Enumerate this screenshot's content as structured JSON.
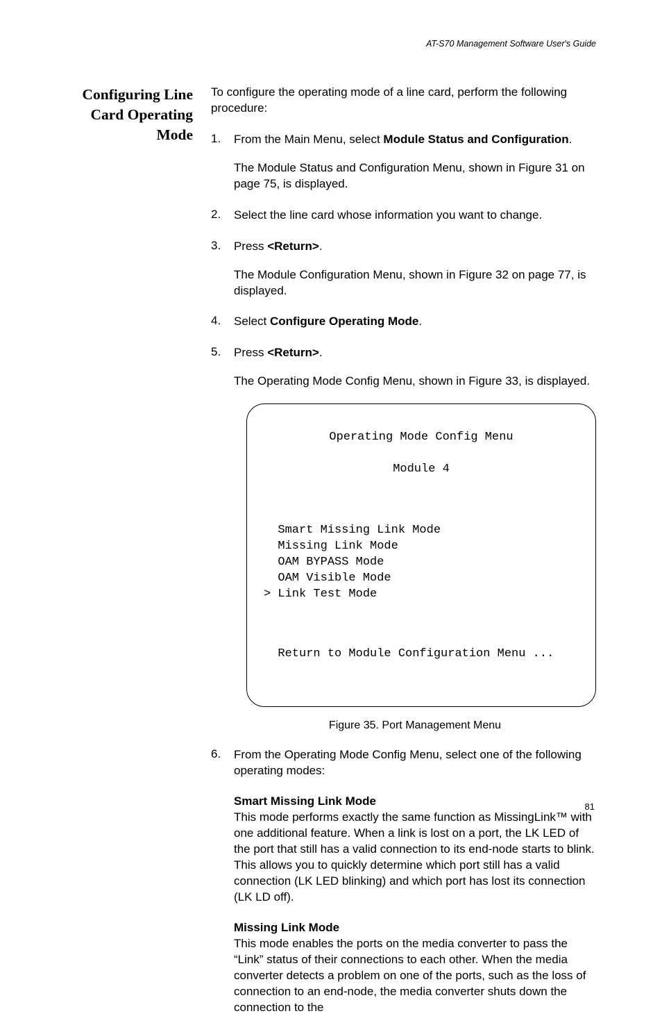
{
  "header": "AT-S70 Management Software User's Guide",
  "sidebarHeading": "Configuring Line Card Operating\nMode",
  "intro": "To configure the operating mode of a line card, perform the following procedure:",
  "steps": {
    "s1": {
      "pre": "From the Main Menu, select ",
      "bold": "Module Status and Configuration",
      "post": ".",
      "after": "The Module Status and Configuration Menu, shown in Figure 31 on page 75, is displayed."
    },
    "s2": {
      "text": "Select the line card whose information you want to change."
    },
    "s3": {
      "pre": "Press ",
      "bold": "<Return>",
      "post": ".",
      "after": "The Module Configuration Menu, shown in Figure 32 on page 77, is displayed."
    },
    "s4": {
      "pre": "Select ",
      "bold": "Configure Operating Mode",
      "post": "."
    },
    "s5": {
      "pre": "Press ",
      "bold": "<Return>",
      "post": ".",
      "after": "The Operating Mode Config Menu, shown in Figure 33, is displayed."
    },
    "s6": {
      "text": "From the Operating Mode Config Menu, select one of the following operating modes:"
    }
  },
  "menu": {
    "title1": "Operating Mode Config Menu",
    "title2": "Module 4",
    "item1": "  Smart Missing Link Mode",
    "item2": "  Missing Link Mode",
    "item3": "  OAM BYPASS Mode",
    "item4": "  OAM Visible Mode",
    "item5": "> Link Test Mode",
    "ret": "  Return to Module Configuration Menu ..."
  },
  "figureCaption": "Figure 35. Port Management Menu",
  "modes": {
    "smart": {
      "title": "Smart Missing Link Mode",
      "body": "This mode performs exactly the same function as MissingLink™ with one additional feature. When a link is lost on a port, the LK LED of the port that still has a valid connection to its end-node starts to blink. This allows you to quickly determine which port still has a valid connection (LK LED blinking) and which port has lost its connection (LK LD off)."
    },
    "missing": {
      "title": "Missing Link Mode",
      "body": "This mode enables the ports on the media converter to pass the “Link” status of their connections to each other. When the media converter detects a problem on one of the ports, such as the loss of connection to an end-node, the media converter shuts down the connection to the"
    }
  },
  "pageNumber": "81"
}
